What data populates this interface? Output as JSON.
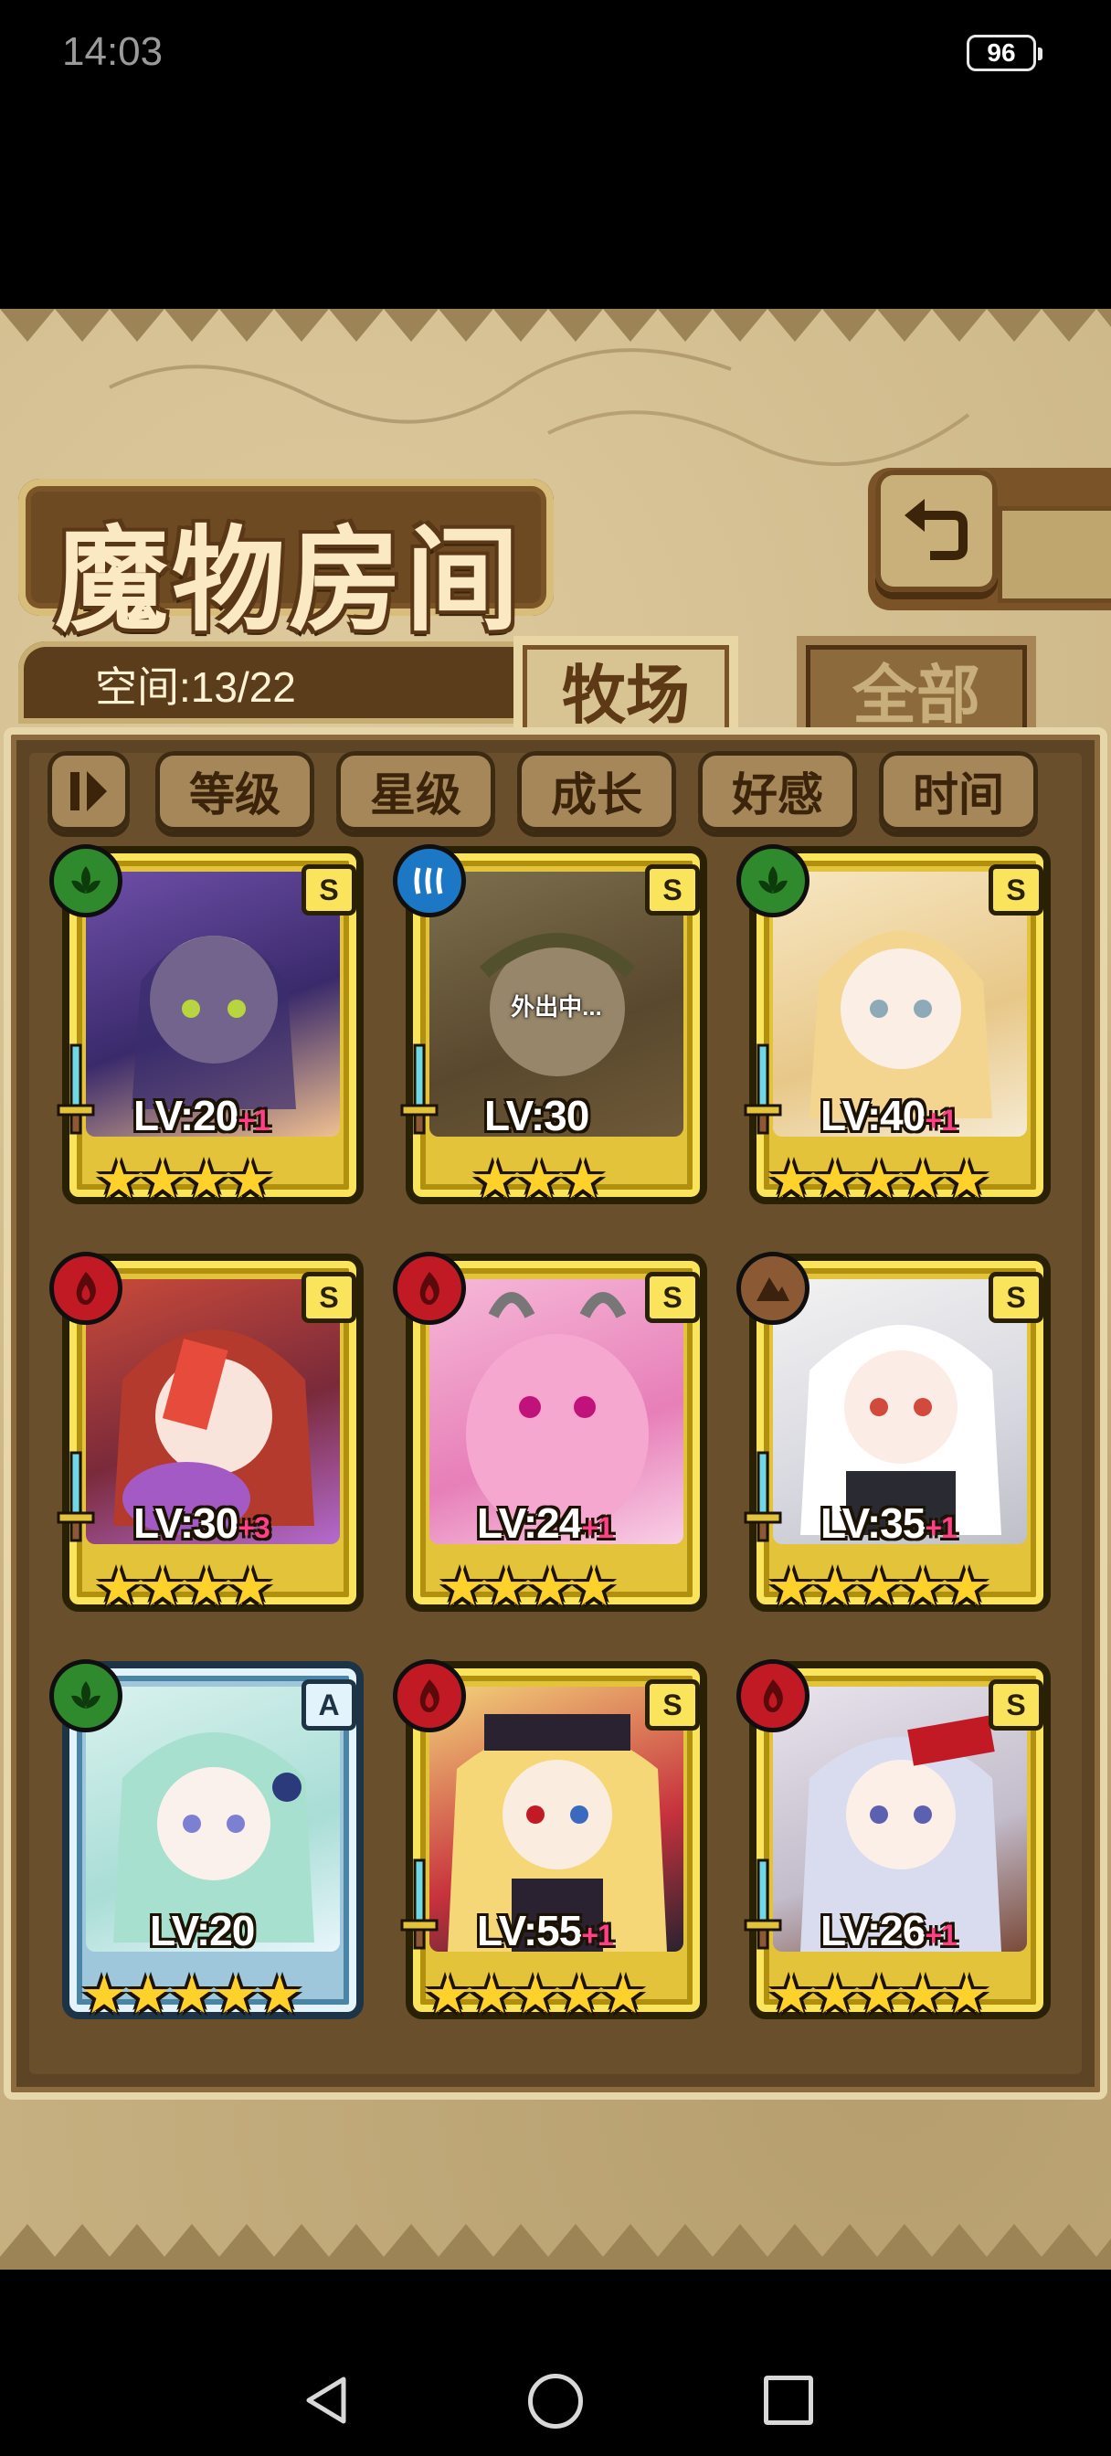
{
  "status_bar": {
    "time": "14:03",
    "battery": "96"
  },
  "header": {
    "title": "魔物房间",
    "back_icon": "return-arrow-icon"
  },
  "space": {
    "label": "空间:13/22"
  },
  "tabs": [
    {
      "label": "牧场",
      "active": true
    },
    {
      "label": "全部",
      "active": false
    }
  ],
  "sort_buttons": [
    {
      "label": "等级"
    },
    {
      "label": "星级"
    },
    {
      "label": "成长"
    },
    {
      "label": "好感"
    },
    {
      "label": "时间"
    }
  ],
  "monsters": [
    {
      "element": "leaf",
      "rank": "S",
      "level": "LV:20",
      "bonus": "+1",
      "stars": 4,
      "status": ""
    },
    {
      "element": "water",
      "rank": "S",
      "level": "LV:30",
      "bonus": "",
      "stars": 3,
      "status": "外出中..."
    },
    {
      "element": "leaf",
      "rank": "S",
      "level": "LV:40",
      "bonus": "+1",
      "stars": 5,
      "status": ""
    },
    {
      "element": "fire",
      "rank": "S",
      "level": "LV:30",
      "bonus": "+3",
      "stars": 4,
      "status": ""
    },
    {
      "element": "fire",
      "rank": "S",
      "level": "LV:24",
      "bonus": "+1",
      "stars": 4,
      "status": ""
    },
    {
      "element": "earth",
      "rank": "S",
      "level": "LV:35",
      "bonus": "+1",
      "stars": 5,
      "status": ""
    },
    {
      "element": "leaf",
      "rank": "A",
      "level": "LV:20",
      "bonus": "",
      "stars": 5,
      "status": ""
    },
    {
      "element": "fire",
      "rank": "S",
      "level": "LV:55",
      "bonus": "+1",
      "stars": 5,
      "status": ""
    },
    {
      "element": "fire",
      "rank": "S",
      "level": "LV:26",
      "bonus": "+1",
      "stars": 5,
      "status": ""
    }
  ],
  "colors": {
    "panel": "#5d4424",
    "gold_frame": "#e2c33a",
    "blue_frame": "#9fc7dc",
    "parchment": "#cbb586"
  }
}
